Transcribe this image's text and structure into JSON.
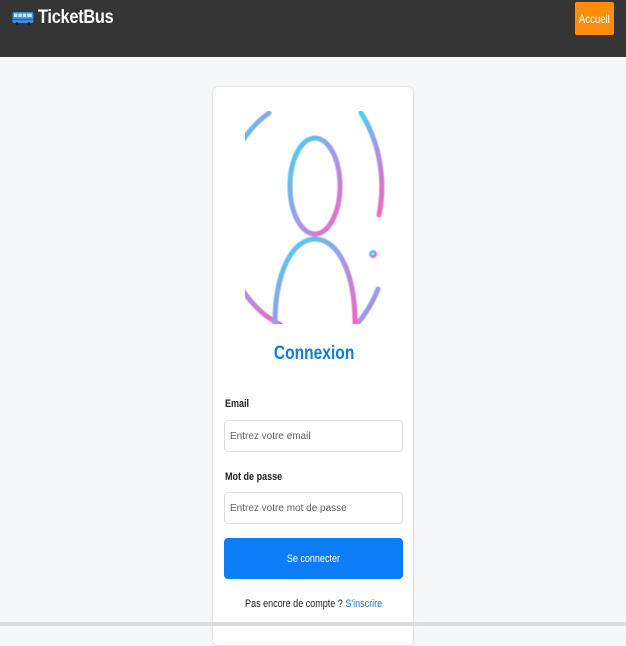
{
  "navbar": {
    "brand_icon": "bus-icon",
    "brand_name": "TicketBus",
    "home_label": "Accueil",
    "bg_color": "#353535",
    "home_color": "#ff8d0b"
  },
  "login": {
    "avatar_icon": "user-circle-gradient-icon",
    "title": "Connexion",
    "email_label": "Email",
    "email_placeholder": "Entrez votre email",
    "password_label": "Mot de passe",
    "password_placeholder": "Entrez votre mot de passe",
    "submit_label": "Se connecter",
    "signup_prompt": "Pas encore de compte ?",
    "signup_link": "S'inscrire",
    "accent_color": "#0d7cf7"
  }
}
